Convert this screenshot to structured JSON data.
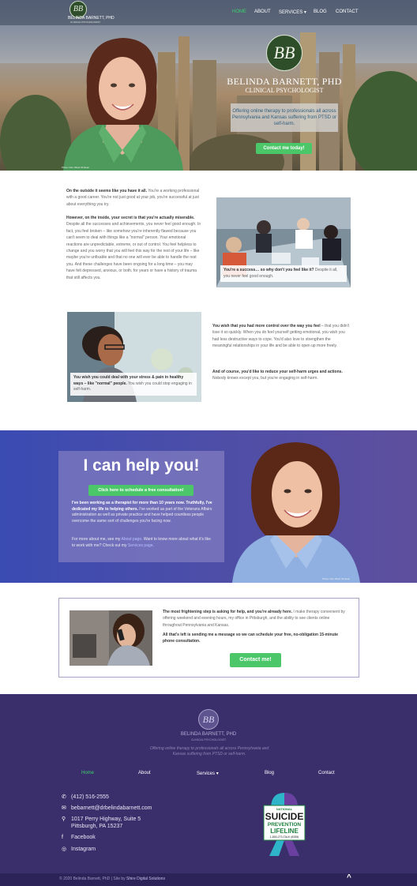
{
  "nav": {
    "logo_text": "BB",
    "brand_name": "BELINDA BARNETT, PHD",
    "brand_sub": "CLINICAL PSYCHOLOGIST",
    "items": [
      {
        "label": "HOME",
        "active": true
      },
      {
        "label": "ABOUT"
      },
      {
        "label": "SERVICES",
        "dropdown": true,
        "caret": "▾"
      },
      {
        "label": "BLOG"
      },
      {
        "label": "CONTACT"
      }
    ]
  },
  "hero": {
    "badge_text": "BB",
    "name": "BELINDA BARNETT, PHD",
    "title": "CLINICAL PSYCHOLOGIST",
    "tagline": "Offering online therapy to professionals all across Pennsylvania and Kansas suffering from PTSD or self-harm.",
    "cta": "Contact me today!",
    "photo_credit": "Photo: Dan Wiest Shulean"
  },
  "intro": {
    "p1_bold": "On the outside it seems like you have it all.",
    "p1": " You're a working professional with a good career. You're not just good at your job, you're successful at just about everything you try.",
    "p2_bold": "However, on the inside, your secret is that you're actually miserable.",
    "p2": " Despite all the successes and achievements, you never feel good enough. In fact, you feel broken – like somehow you're inherently flawed because you can't seem to deal with things like a \"normal\" person. Your emotional reactions are unpredictable, extreme, or out of control. You feel helpless to change and you worry that you will feel this way for the rest of your life – like maybe you're unfixable and that no one will ever be able to handle the rest you. And these challenges have been ongoing for a long time – you may have felt depressed, anxious, or both, for years or have a history of trauma that still affects you.",
    "cap1_bold": "You're a success… so why don't you feel like it?",
    "cap1": " Despite it all, you never feel good enough.",
    "cap2_bold": "You wish you could deal with your stress & pain in healthy ways – like \"normal\" people.",
    "cap2": " You wish you could stop engaging in self-harm.",
    "p3_bold": "You wish that you had more control over the way you feel",
    "p3": " – that you didn't lose it so quickly. When you do feel yourself getting emotional, you wish you had less destructive ways to cope. You'd also love to strengthen the meaningful relationships in your life and be able to open up more freely.",
    "p4_bold": "And of course, you'd like to reduce your self-harm urges and actions.",
    "p4": " Nobody knows except you, but you're engaging in self-harm."
  },
  "help": {
    "heading": "I can help you!",
    "button": "Click here to schedule a free consultation!",
    "p1_bold": "I've been working as a therapist for more than 10 years now. Truthfully, I've dedicated my life to helping others.",
    "p1": " I've worked as part of the Veterans Affairs administration as well as private practice and have helped countless people overcome the same sort of challenges you're facing now.",
    "p2a": "For more about me, see my ",
    "p2_link1": "About page",
    "p2b": ". Want to know more about what it's like to work with me? Check out my ",
    "p2_link2": "Services page",
    "p2c": ".",
    "photo_credit": "Photo: Dan Wiest Shulean"
  },
  "contact": {
    "p1_bold": "The most frightening step is asking for help, and you're already here.",
    "p1": " I make therapy convenient by offering weekend and evening hours, my office in Pittsburgh, and the ability to see clients online throughout Pennsylvania and Kansas.",
    "p2_bold": "All that's left is sending me a message so we can schedule your free, no-obligation 15-minute phone consultation.",
    "button": "Contact me!"
  },
  "footer": {
    "logo_text": "BB",
    "brand_name": "BELINDA BARNETT, PHD",
    "brand_sub": "CLINICAL PSYCHOLOGIST",
    "tagline": "Offering online therapy to professionals all across Pennsylvania and Kansas suffering from PTSD or self-harm.",
    "nav": [
      {
        "label": "Home",
        "active": true
      },
      {
        "label": "About"
      },
      {
        "label": "Services",
        "caret": "▾"
      },
      {
        "label": "Blog"
      },
      {
        "label": "Contact"
      }
    ],
    "phone": "(412) 516-2555",
    "email": "bebarnett@drbelindabarnett.com",
    "address1": "1017 Perry Highway, Suite 5",
    "address2": "Pittsburgh, PA 15237",
    "facebook": "Facebook",
    "instagram": "Instagram",
    "lifeline": {
      "national": "NATIONAL",
      "suicide": "SUICIDE",
      "prevention": "PREVENTION",
      "lifeline": "LIFELINE",
      "phone": "1-800-273-TALK (8255)"
    },
    "copyright_a": "© 2020 Belinda Barnett, PhD | Site by ",
    "copyright_b": "Shire Digital Solutions",
    "back_to_top": "^"
  },
  "colors": {
    "accent_green": "#4bc76a",
    "purple": "#3a2f6b",
    "blue": "#3a4bb2"
  }
}
